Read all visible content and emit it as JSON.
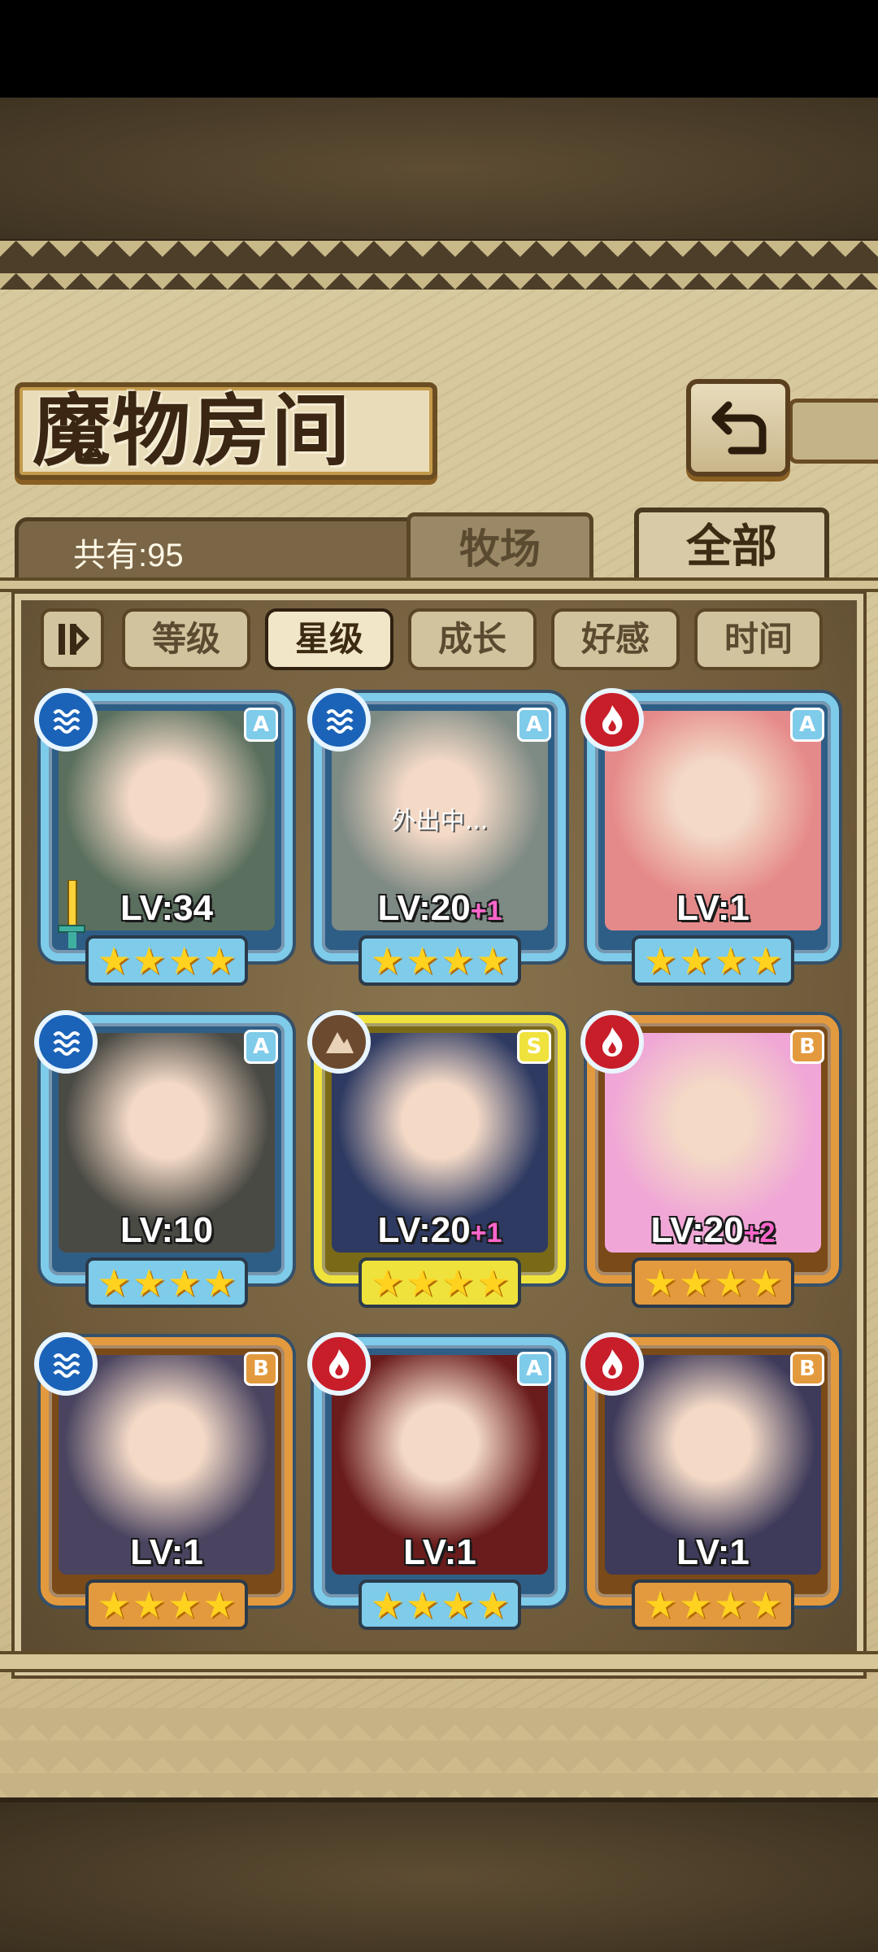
{
  "title": "魔物房间",
  "count_label": "共有:95",
  "tabs": {
    "ranch": "牧场",
    "all": "全部"
  },
  "sort_buttons": [
    "等级",
    "星级",
    "成长",
    "好感",
    "时间"
  ],
  "active_sort": "星级",
  "colors": {
    "frame_blue": "#7ecbea",
    "frame_gold": "#f0e23c",
    "frame_orange": "#e39a3e",
    "star": "#ffd21f"
  },
  "cards": [
    {
      "element": "water",
      "rank": "A",
      "frame": "blue",
      "level": "LV:34",
      "plus": "",
      "stars": 4,
      "status": "",
      "weapon_icon": "sword-icon"
    },
    {
      "element": "water",
      "rank": "A",
      "frame": "blue",
      "level": "LV:20",
      "plus": "+1",
      "stars": 4,
      "status": "外出中...",
      "weapon_icon": ""
    },
    {
      "element": "fire",
      "rank": "A",
      "frame": "blue",
      "level": "LV:1",
      "plus": "",
      "stars": 4,
      "status": "",
      "weapon_icon": ""
    },
    {
      "element": "water",
      "rank": "A",
      "frame": "blue",
      "level": "LV:10",
      "plus": "",
      "stars": 4,
      "status": "",
      "weapon_icon": ""
    },
    {
      "element": "earth",
      "rank": "S",
      "frame": "gold",
      "level": "LV:20",
      "plus": "+1",
      "stars": 4,
      "status": "",
      "weapon_icon": ""
    },
    {
      "element": "fire",
      "rank": "B",
      "frame": "orange",
      "level": "LV:20",
      "plus": "+2",
      "stars": 4,
      "status": "",
      "weapon_icon": ""
    },
    {
      "element": "water",
      "rank": "B",
      "frame": "orange",
      "level": "LV:1",
      "plus": "",
      "stars": 4,
      "status": "",
      "weapon_icon": ""
    },
    {
      "element": "fire",
      "rank": "A",
      "frame": "blue",
      "level": "LV:1",
      "plus": "",
      "stars": 4,
      "status": "",
      "weapon_icon": ""
    },
    {
      "element": "fire",
      "rank": "B",
      "frame": "orange",
      "level": "LV:1",
      "plus": "",
      "stars": 4,
      "status": "",
      "weapon_icon": ""
    }
  ]
}
